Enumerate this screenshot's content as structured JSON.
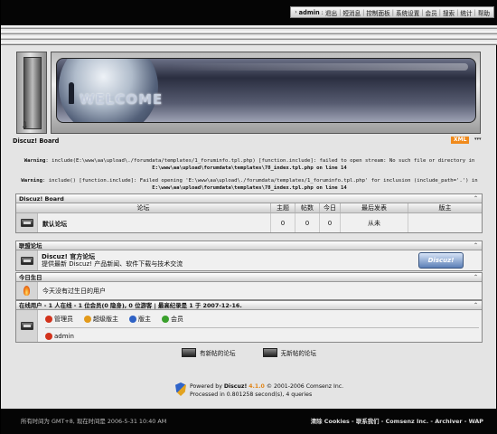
{
  "topnav": {
    "arrow": "›",
    "user": "admin",
    "items": [
      "退出",
      "短消息",
      "控制面板",
      "系统设置",
      "会员",
      "搜索",
      "统计",
      "帮助"
    ]
  },
  "banner": {
    "text": "WELCOME"
  },
  "board": {
    "title": "Discuz! Board",
    "xml": "XML",
    "xml_arrow": "▾▾▾"
  },
  "warnings": [
    {
      "label": "Warning",
      "line1": ": include(E:\\www\\aa\\upload\\./forumdata/templates/1_foruminfo.tpl.php) [function.include]: failed to open stream: No such file or directory in",
      "line2": "E:\\www\\aa\\upload\\forumdata\\templates\\78_index.tpl.php on line 14"
    },
    {
      "label": "Warning",
      "line1": ": include() [function.include]: Failed opening 'E:\\www\\aa\\upload\\./forumdata/templates/1_foruminfo.tpl.php' for inclusion (include_path='.') in",
      "line2": "E:\\www\\aa\\upload\\forumdata\\templates\\78_index.tpl.php on line 14"
    }
  ],
  "forum_section": {
    "title": "Discuz! Board",
    "collapse": "⌃",
    "columns": [
      "论坛",
      "主题",
      "帖数",
      "今日",
      "最后发表",
      "版主"
    ],
    "rows": [
      {
        "name": "默认论坛",
        "topics": "0",
        "posts": "0",
        "today": "0",
        "last_post": "从未",
        "moderator": ""
      }
    ]
  },
  "union_section": {
    "title": "联盟论坛",
    "collapse": "⌃",
    "name": "Discuz! 官方论坛",
    "desc": "提供最新 Discuz! 产品新闻、软件下载与技术交流",
    "logo": "Discuz!"
  },
  "birthday_section": {
    "title": "今日生日",
    "collapse": "⌃",
    "text": "今天没有过生日的用户"
  },
  "online_section": {
    "title": "在线用户 - 1 人在线 - 1 位会员(0 隐身), 0 位游客 | 最高纪录是 1 于 2007-12-16.",
    "collapse": "⌃",
    "legend": [
      "管理员",
      "超级版主",
      "版主",
      "会员"
    ],
    "users": [
      "admin"
    ]
  },
  "legend_bottom": {
    "new": "有新帖的论坛",
    "none": "无新帖的论坛"
  },
  "powered": {
    "prefix": "Powered by",
    "product": "Discuz!",
    "version": "4.1.0",
    "copyright": "© 2001-2006 Comsenz Inc.",
    "processed": "Processed in 0.801258 second(s), 4 queries"
  },
  "footer": {
    "time": "所有时间为 GMT+8, 现在时间是 2006-5-31 10:40 AM",
    "links": "清除 Cookies - 联系我们 - Comsenz Inc. - Archiver - WAP"
  },
  "colors": {
    "xml": "#f08a1c",
    "version": "#e1861a",
    "admin_icon": "#d2331c",
    "supermod_icon": "#e39a1a",
    "mod_icon": "#2f62c5",
    "member_icon": "#3aa02c"
  }
}
